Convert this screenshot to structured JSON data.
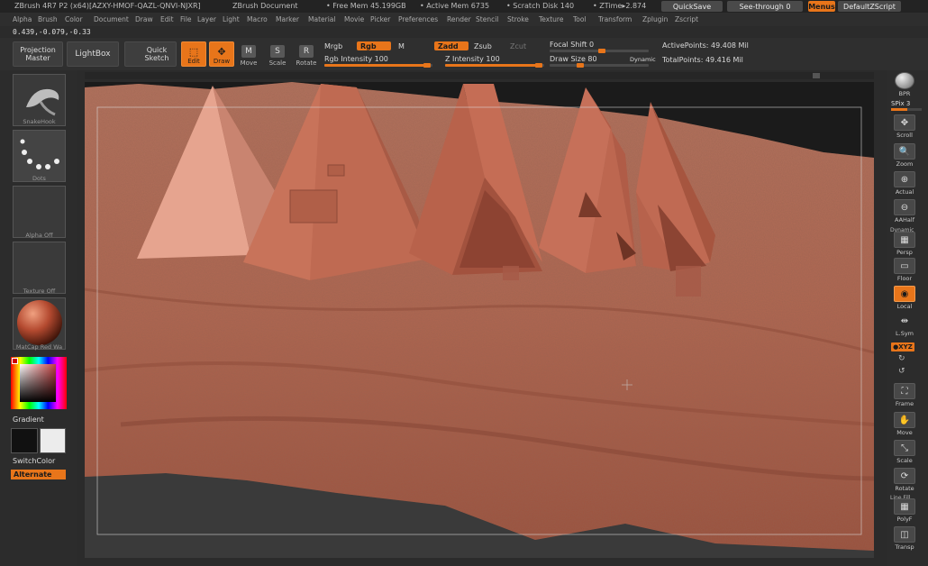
{
  "titlebar": {
    "app": "ZBrush 4R7 P2 (x64)[AZXY-HMOF-QAZL-QNVI-NJXR]",
    "document": "ZBrush Document",
    "free_mem": "• Free Mem 45.199GB",
    "active_mem": "• Active Mem 6735",
    "scratch": "• Scratch Disk 140",
    "ztime": "• ZTime▸2.874",
    "quicksave": "QuickSave",
    "seethrough": "See-through 0",
    "menus": "Menus",
    "script": "DefaultZScript"
  },
  "menu": [
    "Alpha",
    "Brush",
    "Color",
    "Document",
    "Draw",
    "Edit",
    "File",
    "Layer",
    "Light",
    "Macro",
    "Marker",
    "Material",
    "Movie",
    "Picker",
    "Preferences",
    "Render",
    "Stencil",
    "Stroke",
    "Texture",
    "Tool",
    "Transform",
    "Zplugin",
    "Zscript"
  ],
  "coords": "0.439,-0.079,-0.33",
  "shelf": {
    "projection_master": "Projection Master",
    "lightbox": "LightBox",
    "quick_sketch": "Quick Sketch",
    "edit": "Edit",
    "draw": "Draw",
    "move": "Move",
    "scale": "Scale",
    "rotate": "Rotate",
    "mrgb": "Mrgb",
    "rgb": "Rgb",
    "m": "M",
    "zadd": "Zadd",
    "zsub": "Zsub",
    "zcut": "Zcut",
    "rgb_intensity": "Rgb Intensity 100",
    "z_intensity": "Z Intensity 100",
    "focal_shift": "Focal Shift 0",
    "draw_size": "Draw Size 80",
    "dynamic": "Dynamic",
    "active_points": "ActivePoints: 49.408 Mil",
    "total_points": "TotalPoints: 49.416 Mil"
  },
  "left": {
    "brush": "SnakeHook",
    "stroke": "Dots",
    "alpha": "Alpha Off",
    "texture": "Texture Off",
    "material": "MatCap Red Wa",
    "gradient": "Gradient",
    "switchcolor": "SwitchColor",
    "alternate": "Alternate"
  },
  "right": {
    "bpr": "BPR",
    "spix": "SPix 3",
    "scroll": "Scroll",
    "zoom": "Zoom",
    "actual": "Actual",
    "aahalf": "AAHalf",
    "dynamic": "Dynamic",
    "persp": "Persp",
    "floor": "Floor",
    "local": "Local",
    "lsym": "L.Sym",
    "xyz": "●XYZ",
    "frame": "Frame",
    "move": "Move",
    "scale": "Scale",
    "rotate": "Rotate",
    "linefill": "Line Fill",
    "polyf": "PolyF",
    "transp": "Transp"
  },
  "colors": {
    "accent": "#e8751a",
    "clay": "#b96a52",
    "background": "#2b2b2b"
  }
}
